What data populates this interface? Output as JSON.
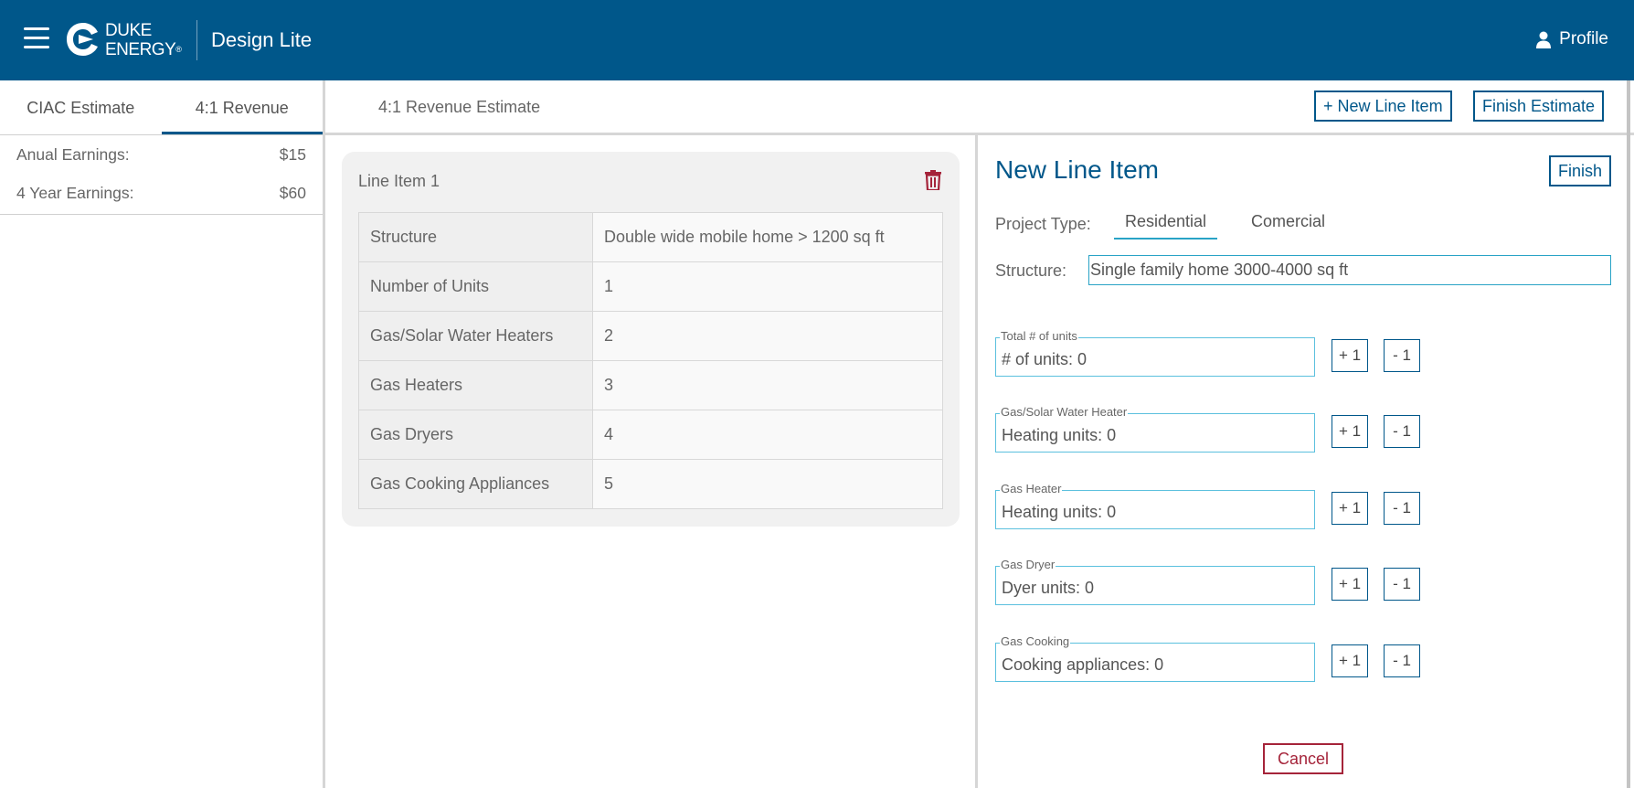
{
  "header": {
    "logo_line1": "DUKE",
    "logo_line2": "ENERGY",
    "logo_reg": "®",
    "app_title": "Design Lite",
    "profile_label": "Profile"
  },
  "left_tabs": [
    {
      "label": "CIAC Estimate",
      "active": false
    },
    {
      "label": "4:1 Revenue",
      "active": true
    }
  ],
  "earnings": [
    {
      "label": "Anual Earnings:",
      "value": "$15"
    },
    {
      "label": "4 Year Earnings:",
      "value": "$60"
    }
  ],
  "topbar": {
    "title": "4:1 Revenue Estimate",
    "new_line_item_label": "+ New Line Item",
    "finish_estimate_label": "Finish Estimate"
  },
  "line_item": {
    "title": "Line Item 1",
    "rows": [
      {
        "key": "Structure",
        "value": "Double wide mobile home > 1200 sq ft"
      },
      {
        "key": "Number of Units",
        "value": "1"
      },
      {
        "key": "Gas/Solar Water Heaters",
        "value": "2"
      },
      {
        "key": "Gas Heaters",
        "value": "3"
      },
      {
        "key": "Gas Dryers",
        "value": "4"
      },
      {
        "key": "Gas Cooking Appliances",
        "value": "5"
      }
    ]
  },
  "new_line_item": {
    "title": "New Line Item",
    "finish_label": "Finish",
    "project_type_label": "Project Type:",
    "project_types": [
      {
        "label": "Residential",
        "active": true
      },
      {
        "label": "Comercial",
        "active": false
      }
    ],
    "structure_label": "Structure:",
    "structure_value": "Single family home 3000-4000 sq ft",
    "counters": [
      {
        "legend": "Total # of units",
        "value": "# of units: 0",
        "plus": "+ 1",
        "minus": "- 1"
      },
      {
        "legend": "Gas/Solar Water Heater",
        "value": "Heating units: 0",
        "plus": "+ 1",
        "minus": "- 1"
      },
      {
        "legend": "Gas Heater",
        "value": "Heating units: 0",
        "plus": "+ 1",
        "minus": "- 1"
      },
      {
        "legend": "Gas Dryer",
        "value": "Dyer units: 0",
        "plus": "+ 1",
        "minus": "- 1"
      },
      {
        "legend": "Gas Cooking",
        "value": "Cooking appliances: 0",
        "plus": "+ 1",
        "minus": "- 1"
      }
    ],
    "cancel_label": "Cancel"
  },
  "colors": {
    "brand": "#00578a",
    "input_border": "#29a3c6",
    "danger": "#a5243a"
  }
}
